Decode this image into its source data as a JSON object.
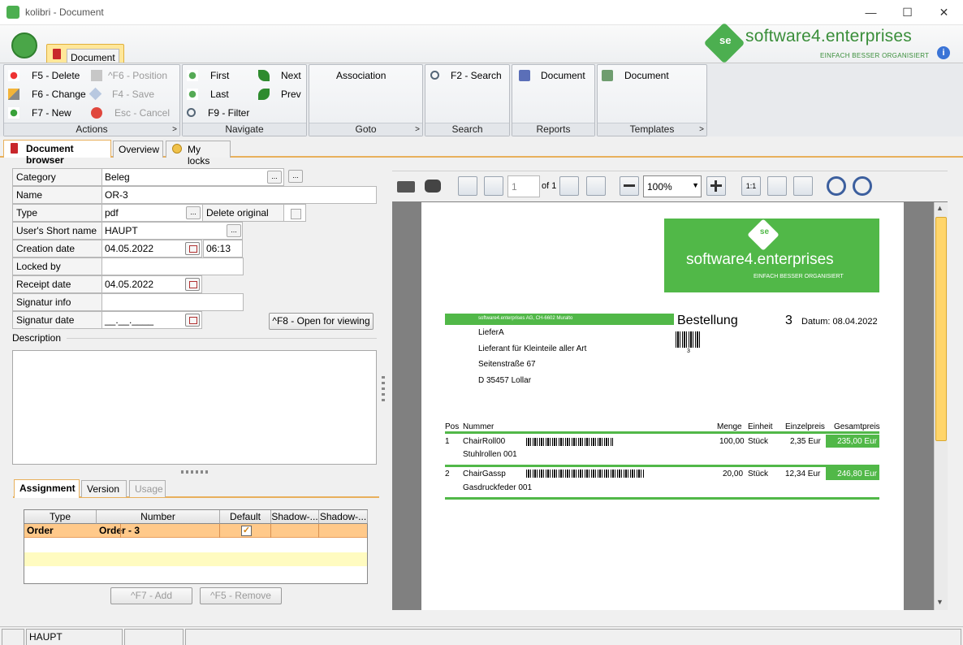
{
  "window": {
    "title": "kolibri - Document",
    "minimize": "—",
    "maximize": "☐",
    "close": "✕"
  },
  "ribbon": {
    "tab": "Document",
    "brand": {
      "name": "software4.enterprises",
      "tagline": "EINFACH BESSER ORGANISIERT",
      "logo": "se",
      "info": "i"
    },
    "actions": {
      "title": "Actions",
      "delete": "F5 - Delete",
      "change": "F6 - Change",
      "new": "F7 - New",
      "position": "^F6 - Position",
      "save": "F4 - Save",
      "cancel": "Esc - Cancel"
    },
    "navigate": {
      "title": "Navigate",
      "first": "First",
      "last": "Last",
      "filter": "F9 - Filter",
      "next": "Next",
      "prev": "Prev"
    },
    "goto": {
      "title": "Goto",
      "association": "Association"
    },
    "search": {
      "title": "Search",
      "search": "F2 - Search"
    },
    "reports": {
      "title": "Reports",
      "document": "Document"
    },
    "templates": {
      "title": "Templates",
      "document": "Document"
    }
  },
  "tabs": [
    "Document browser",
    "Overview",
    "My locks"
  ],
  "form": {
    "category": {
      "label": "Category",
      "value": "Beleg"
    },
    "name": {
      "label": "Name",
      "value": "OR-3"
    },
    "type": {
      "label": "Type",
      "value": "pdf"
    },
    "delete_original": "Delete original",
    "short_name": {
      "label": "User's Short name",
      "value": "HAUPT"
    },
    "creation_date": {
      "label": "Creation date",
      "value": "04.05.2022",
      "time": "06:13"
    },
    "locked_by": {
      "label": "Locked by",
      "value": ""
    },
    "receipt_date": {
      "label": "Receipt date",
      "value": "04.05.2022"
    },
    "signatur_info": {
      "label": "Signatur info",
      "value": ""
    },
    "signatur_date": {
      "label": "Signatur date",
      "value": "__.__.____"
    },
    "open_button": "^F8 - Open for viewing",
    "description_label": "Description",
    "ellipsis": "..."
  },
  "subtabs": [
    "Assignment",
    "Version",
    "Usage"
  ],
  "assignment": {
    "columns": [
      "Type",
      "Number",
      "Default",
      "Shadow-...",
      "Shadow-..."
    ],
    "rows": [
      {
        "type": "Order",
        "number": "Order - 3",
        "default": "✓"
      }
    ],
    "add": "^F7 - Add",
    "remove": "^F5 - Remove"
  },
  "viewer": {
    "page_num": "1",
    "page_of": "of 1",
    "zoom": "100%",
    "zoom_arrow": "▼",
    "fit_actual": "1:1",
    "scroll_up": "▲",
    "scroll_down": "▼"
  },
  "document": {
    "brand": "software4.enterprises",
    "tagline": "EINFACH BESSER ORGANISIERT",
    "logo": "se",
    "sender": "software4.enterprises AG, CH-6602 Muralto",
    "title": "Bestellung",
    "number": "3",
    "barcode_num": "3",
    "date": "Datum:  08.04.2022",
    "address": [
      "LieferA",
      "Lieferant für Kleinteile aller Art",
      "Seitenstraße 67",
      "D 35457 Lollar"
    ],
    "headers": {
      "pos": "Pos",
      "nummer": "Nummer",
      "menge": "Menge",
      "einheit": "Einheit",
      "einzelpreis": "Einzelpreis",
      "gesamtpreis": "Gesamtpreis"
    },
    "items": [
      {
        "pos": "1",
        "nummer": "ChairRoll00",
        "desc": "Stuhlrollen 001",
        "menge": "100,00",
        "einheit": "Stück",
        "einzel": "2,35 Eur",
        "gesamt": "235,00 Eur"
      },
      {
        "pos": "2",
        "nummer": "ChairGassp",
        "desc": "Gasdruckfeder 001",
        "menge": "20,00",
        "einheit": "Stück",
        "einzel": "12,34 Eur",
        "gesamt": "246,80 Eur"
      }
    ]
  },
  "status": {
    "user": "HAUPT"
  }
}
